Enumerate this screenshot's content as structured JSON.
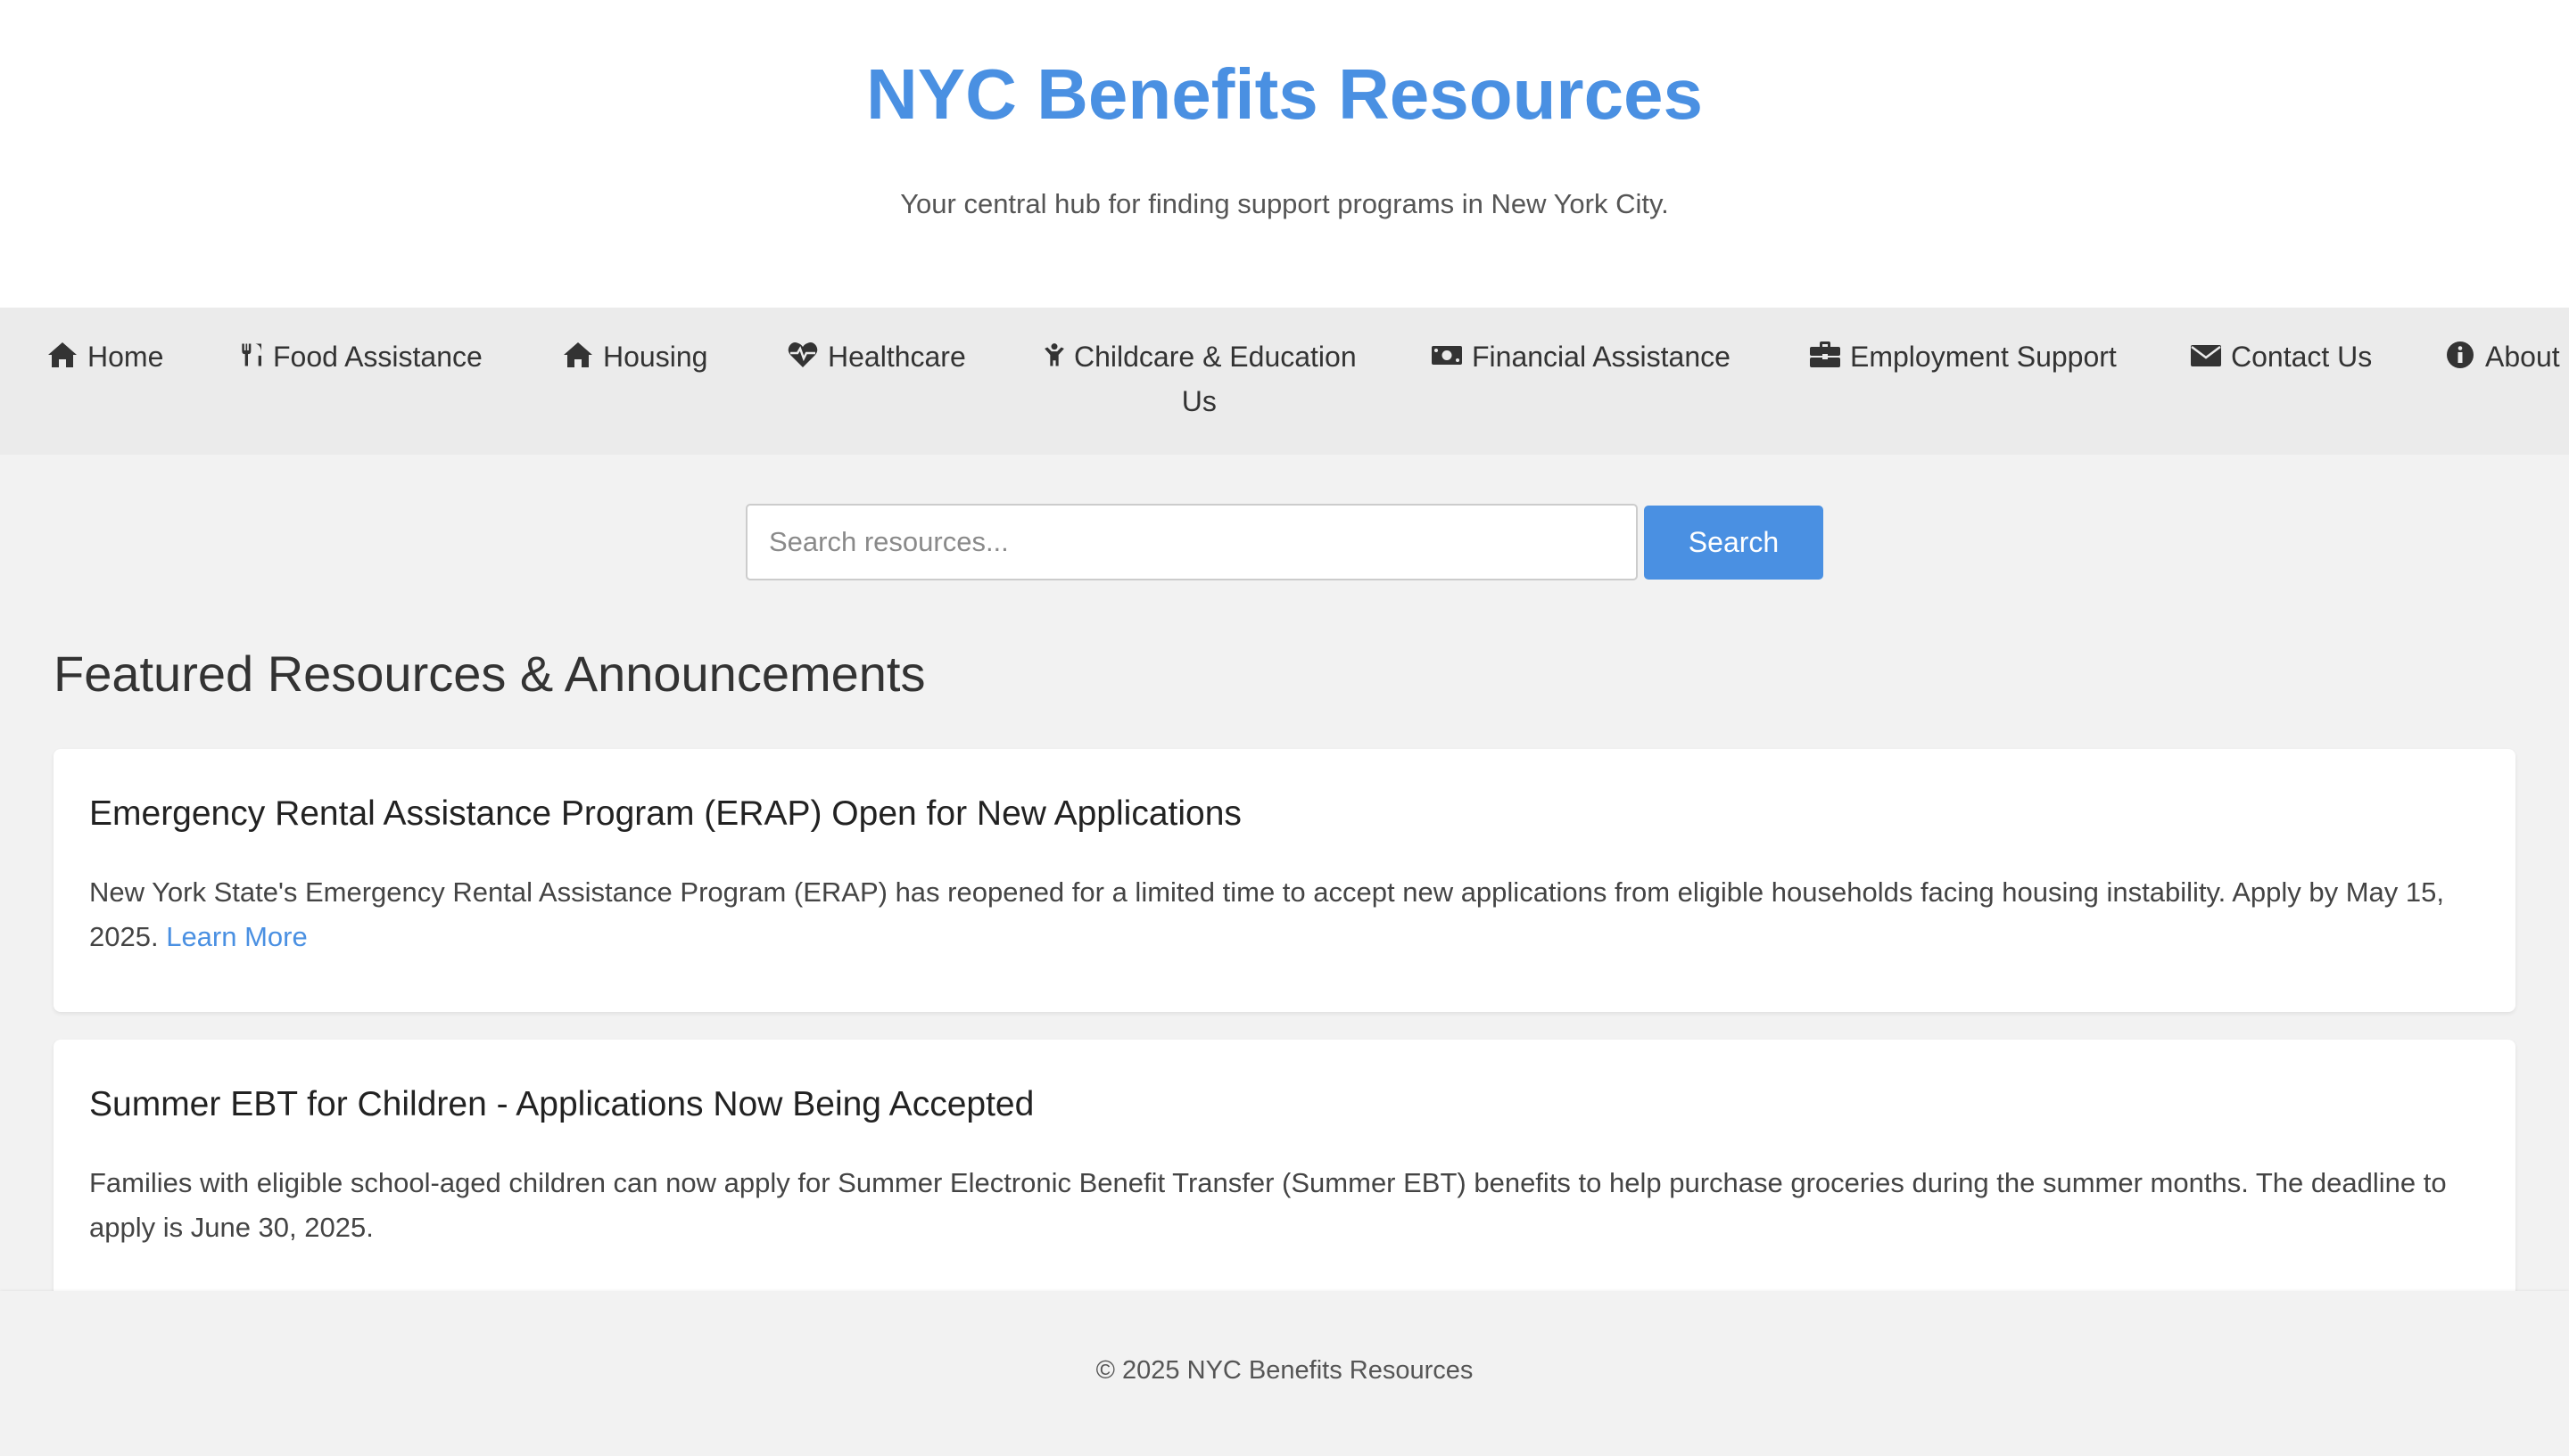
{
  "header": {
    "title": "NYC Benefits Resources",
    "tagline": "Your central hub for finding support programs in New York City."
  },
  "nav": {
    "items": [
      {
        "label": "Home",
        "icon": "home-icon"
      },
      {
        "label": "Food Assistance",
        "icon": "utensils-icon"
      },
      {
        "label": "Housing",
        "icon": "home-icon"
      },
      {
        "label": "Healthcare",
        "icon": "heartbeat-icon"
      },
      {
        "label": "Childcare & Education",
        "label_line2": "Us",
        "icon": "child-icon"
      },
      {
        "label": "Financial Assistance",
        "icon": "money-bill-icon"
      },
      {
        "label": "Employment Support",
        "icon": "briefcase-icon"
      },
      {
        "label": "Contact Us",
        "icon": "envelope-icon"
      },
      {
        "label": "About",
        "icon": "info-circle-icon"
      }
    ]
  },
  "search": {
    "placeholder": "Search resources...",
    "value": "",
    "button_label": "Search"
  },
  "featured": {
    "heading": "Featured Resources & Announcements",
    "cards": [
      {
        "title": "Emergency Rental Assistance Program (ERAP) Open for New Applications",
        "body": "New York State's Emergency Rental Assistance Program (ERAP) has reopened for a limited time to accept new applications from eligible households facing housing instability. Apply by May 15, 2025.",
        "link_label": "Learn More"
      },
      {
        "title": "Summer EBT for Children - Applications Now Being Accepted",
        "body": "Families with eligible school-aged children can now apply for Summer Electronic Benefit Transfer (Summer EBT) benefits to help purchase groceries during the summer months. The deadline to apply is June 30, 2025."
      }
    ]
  },
  "footer": {
    "text": "© 2025 NYC Benefits Resources"
  },
  "colors": {
    "accent": "#4a90e2",
    "page_background": "#f2f2f2",
    "nav_background": "#ebebeb",
    "text": "#333333"
  }
}
